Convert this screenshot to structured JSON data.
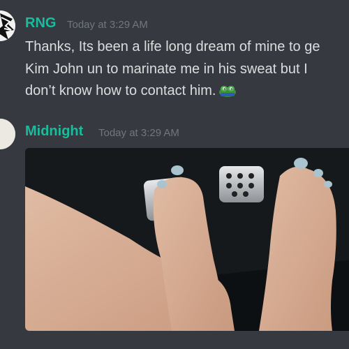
{
  "messages": [
    {
      "author": "RNG",
      "timestamp": "Today at 3:29 AM",
      "lines": [
        "Thanks, Its been a life long dream of mine to ge",
        "Kim John un to marinate me in his sweat but I",
        "don’t know how to contact him."
      ],
      "emoji": "frog-emoji"
    },
    {
      "author": "Midnight",
      "timestamp": "Today at 3:29 AM",
      "attachment": "image-attachment"
    }
  ],
  "colors": {
    "background": "#36393f",
    "author": "#1abc9c",
    "timestamp": "#72767d",
    "text": "#dcddde"
  }
}
